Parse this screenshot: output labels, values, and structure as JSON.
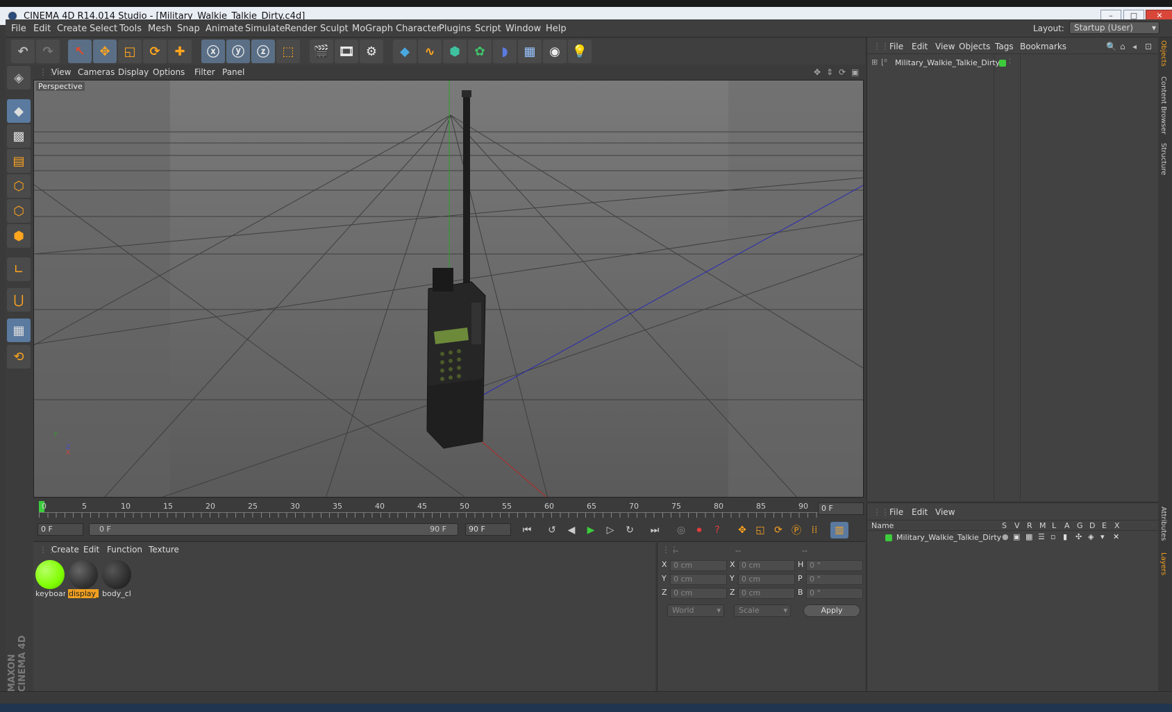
{
  "window": {
    "title": "CINEMA 4D R14.014 Studio - [Military_Walkie_Talkie_Dirty.c4d]",
    "min": "–",
    "max": "□",
    "close": "✕"
  },
  "menu": [
    "File",
    "Edit",
    "Create",
    "Select",
    "Tools",
    "Mesh",
    "Snap",
    "Animate",
    "Simulate",
    "Render",
    "Sculpt",
    "MoGraph",
    "Character",
    "Plugins",
    "Script",
    "Window",
    "Help"
  ],
  "layout": {
    "label": "Layout:",
    "value": "Startup (User)"
  },
  "viewport": {
    "menu": [
      "View",
      "Cameras",
      "Display",
      "Options",
      "Filter",
      "Panel"
    ],
    "label": "Perspective",
    "axis": {
      "y": "Y",
      "x": "X",
      "z": "Z"
    }
  },
  "timeline": {
    "ticks": [
      "0",
      "5",
      "10",
      "15",
      "20",
      "25",
      "30",
      "35",
      "40",
      "45",
      "50",
      "55",
      "60",
      "65",
      "70",
      "75",
      "80",
      "85",
      "90"
    ],
    "current_frame": "0 F",
    "start": "0 F",
    "range_start": "0 F",
    "range_end": "90 F",
    "end": "90 F"
  },
  "materials": {
    "menu": [
      "Create",
      "Edit",
      "Function",
      "Texture"
    ],
    "items": [
      {
        "label": "keyboar",
        "color": "#7fff00"
      },
      {
        "label": "display_",
        "color": "#333"
      },
      {
        "label": "body_cl",
        "color": "#2e2e2e"
      }
    ]
  },
  "coords": {
    "headers": [
      "--",
      "--",
      "--"
    ],
    "rows": [
      {
        "a": "X",
        "av": "0 cm",
        "b": "X",
        "bv": "0 cm",
        "c": "H",
        "cv": "0 °"
      },
      {
        "a": "Y",
        "av": "0 cm",
        "b": "Y",
        "bv": "0 cm",
        "c": "P",
        "cv": "0 °"
      },
      {
        "a": "Z",
        "av": "0 cm",
        "b": "Z",
        "bv": "0 cm",
        "c": "B",
        "cv": "0 °"
      }
    ],
    "world": "World",
    "scale": "Scale",
    "apply": "Apply"
  },
  "objects": {
    "menu": [
      "File",
      "Edit",
      "View",
      "Objects",
      "Tags",
      "Bookmarks"
    ],
    "item": "Military_Walkie_Talkie_Dirty"
  },
  "layers": {
    "menu": [
      "File",
      "Edit",
      "View"
    ],
    "header": "Name",
    "cols": [
      "S",
      "V",
      "R",
      "M",
      "L",
      "A",
      "G",
      "D",
      "E",
      "X"
    ],
    "item": "Military_Walkie_Talkie_Dirty"
  },
  "sidetabs": [
    "Objects",
    "Content Browser",
    "Structure",
    "Attributes",
    "Layers"
  ],
  "brand": "MAXON CINEMA 4D",
  "accent": "#5a7aa0"
}
